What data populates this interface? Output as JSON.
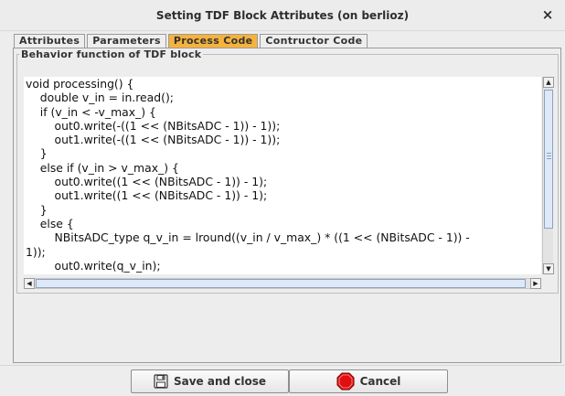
{
  "window": {
    "title": "Setting TDF Block Attributes (on berlioz)",
    "close_glyph": "×"
  },
  "tabs": [
    {
      "label": "Attributes",
      "active": false
    },
    {
      "label": "Parameters",
      "active": false
    },
    {
      "label": "Process Code",
      "active": true
    },
    {
      "label": "Contructor Code",
      "active": false
    }
  ],
  "group": {
    "title": "Behavior function of TDF block"
  },
  "code": {
    "text": "void processing() {\n    double v_in = in.read();\n    if (v_in < -v_max_) {\n        out0.write(-((1 << (NBitsADC - 1)) - 1));\n        out1.write(-((1 << (NBitsADC - 1)) - 1));\n    }\n    else if (v_in > v_max_) {\n        out0.write((1 << (NBitsADC - 1)) - 1);\n        out1.write((1 << (NBitsADC - 1)) - 1);\n    }\n    else {\n        NBitsADC_type q_v_in = lround((v_in / v_max_) * ((1 << (NBitsADC - 1)) -\n1));\n        out0.write(q_v_in);"
  },
  "buttons": {
    "save_label": "Save and close",
    "cancel_label": "Cancel"
  },
  "icons": {
    "save": "floppy-disk-icon",
    "cancel": "stop-sign-icon"
  },
  "colors": {
    "active_tab": "#f6b33c",
    "stop_red": "#e01010"
  }
}
